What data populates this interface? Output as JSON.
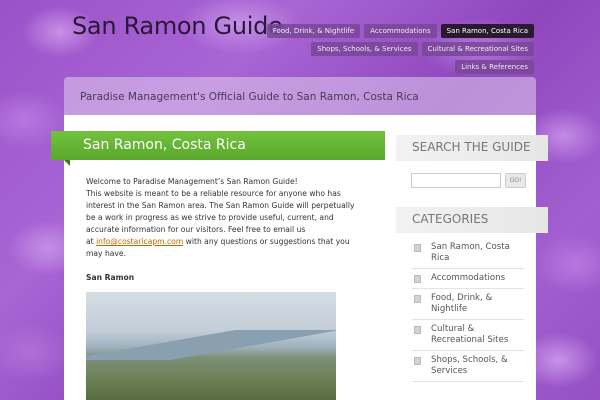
{
  "site": {
    "title": "San Ramon Guide",
    "tagline": "Paradise Management's Official Guide to San Ramon, Costa Rica"
  },
  "nav": {
    "row1": [
      "Food, Drink, & Nightlife",
      "Accommodations",
      "San Ramon, Costa Rica"
    ],
    "row2": [
      "Shops, Schools, & Services",
      "Cultural & Recreational Sites"
    ],
    "row3": [
      "Links & References"
    ],
    "active": "San Ramon, Costa Rica"
  },
  "post": {
    "title": "San Ramon, Costa Rica",
    "intro_line1": "Welcome to Paradise Management’s San Ramon Guide!",
    "intro_body": "This website is meant to be a reliable resource for anyone who has interest in the San Ramon area. The San Ramon Guide will perpetually be a work in progress as we strive to provide useful, current, and accurate information for our visitors. Feel free to email us",
    "at": "at",
    "email": "info@costaricapm.com",
    "after_email": "with any questions or suggestions that you may have.",
    "section_heading": "San Ramon"
  },
  "sidebar": {
    "search_title": "SEARCH THE GUIDE",
    "search_placeholder": "",
    "search_button": "GO!",
    "categories_title": "CATEGORIES",
    "categories": [
      "San Ramon, Costa Rica",
      "Accommodations",
      "Food, Drink, & Nightlife",
      "Cultural & Recreational Sites",
      "Shops, Schools, & Services"
    ]
  },
  "colors": {
    "title_band": "#5aa82c",
    "nav_active": "#2a1a30",
    "link": "#c06a00"
  }
}
